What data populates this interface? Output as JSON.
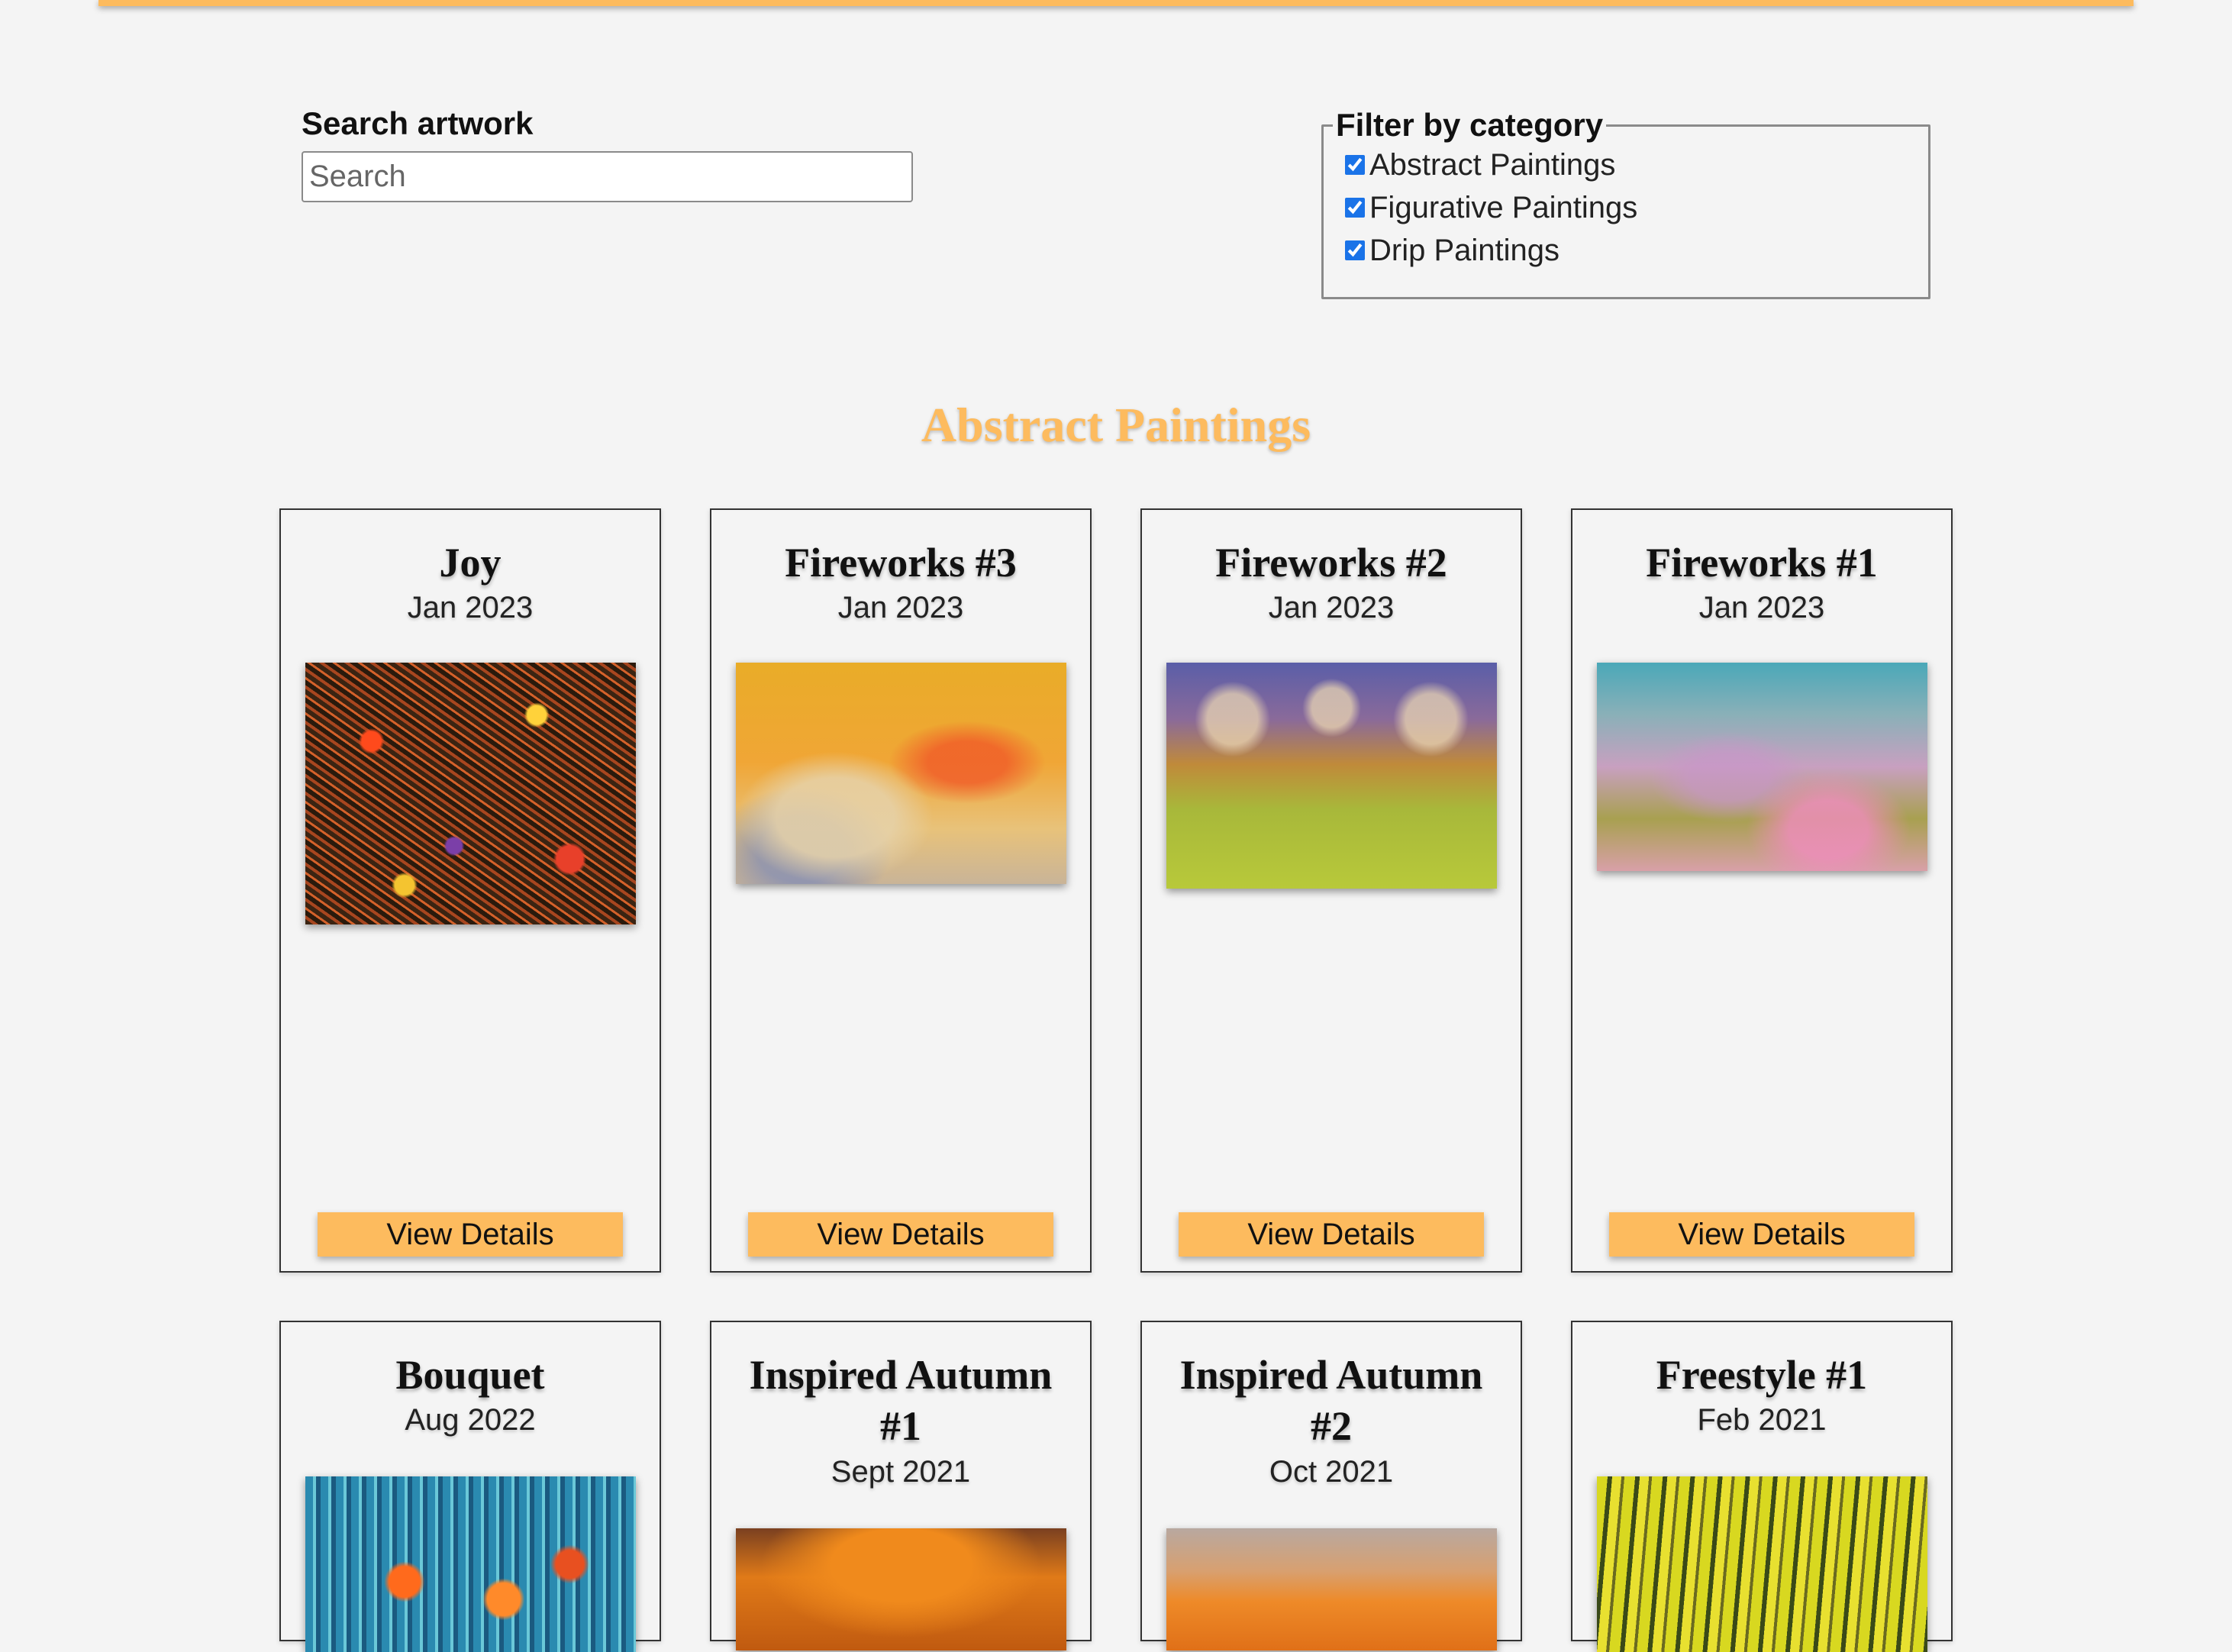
{
  "search": {
    "label": "Search artwork",
    "placeholder": "Search",
    "value": ""
  },
  "filter": {
    "legend": "Filter by category",
    "options": [
      {
        "label": "Abstract Paintings",
        "checked": true
      },
      {
        "label": "Figurative Paintings",
        "checked": true
      },
      {
        "label": "Drip Paintings",
        "checked": true
      }
    ]
  },
  "colors": {
    "accent": "#fdbb5e",
    "background": "#f4f4f4",
    "checkbox": "#1a73e8"
  },
  "section": {
    "title": "Abstract Paintings"
  },
  "artworks": [
    {
      "title": "Joy",
      "date": "Jan 2023",
      "button": "View Details"
    },
    {
      "title": "Fireworks #3",
      "date": "Jan 2023",
      "button": "View Details"
    },
    {
      "title": "Fireworks #2",
      "date": "Jan 2023",
      "button": "View Details"
    },
    {
      "title": "Fireworks #1",
      "date": "Jan 2023",
      "button": "View Details"
    },
    {
      "title": "Bouquet",
      "date": "Aug 2022"
    },
    {
      "title": "Inspired Autumn #1",
      "date": "Sept 2021"
    },
    {
      "title": "Inspired Autumn #2",
      "date": "Oct 2021"
    },
    {
      "title": "Freestyle #1",
      "date": "Feb 2021"
    }
  ]
}
